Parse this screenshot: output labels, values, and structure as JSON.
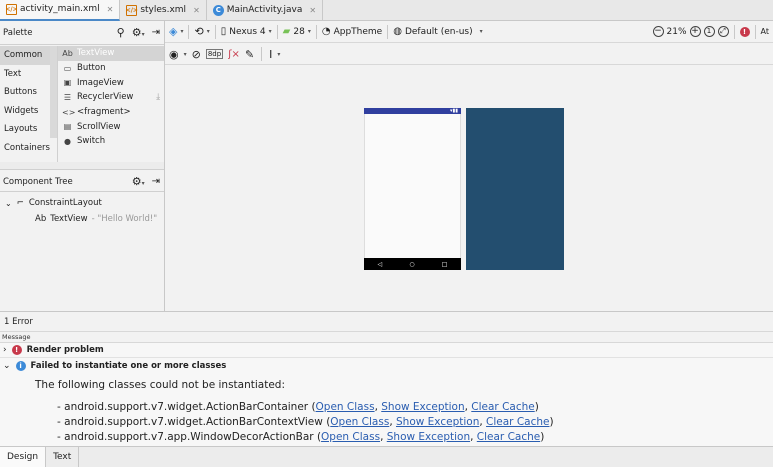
{
  "tabs": [
    {
      "label": "activity_main.xml",
      "icon": "xml-file-icon",
      "active": true
    },
    {
      "label": "styles.xml",
      "icon": "xml-file-icon",
      "active": false
    },
    {
      "label": "MainActivity.java",
      "icon": "java-class-icon",
      "active": false
    }
  ],
  "palette": {
    "title": "Palette",
    "categories": [
      "Common",
      "Text",
      "Buttons",
      "Widgets",
      "Layouts",
      "Containers"
    ],
    "items": [
      {
        "icon_text": "Ab",
        "label": "TextView"
      },
      {
        "icon_text": "▭",
        "label": "Button"
      },
      {
        "icon_text": "▣",
        "label": "ImageView"
      },
      {
        "icon_text": "☰",
        "label": "RecyclerView"
      },
      {
        "icon_text": "<>",
        "label": "<fragment>"
      },
      {
        "icon_text": "▤",
        "label": "ScrollView"
      },
      {
        "icon_text": "●",
        "label": "Switch"
      }
    ]
  },
  "component_tree": {
    "title": "Component Tree",
    "root": "ConstraintLayout",
    "child_icon": "Ab",
    "child": "TextView",
    "child_detail": "- \"Hello World!\""
  },
  "toolbar": {
    "device": "Nexus 4",
    "api": "28",
    "theme": "AppTheme",
    "locale": "Default (en-us)",
    "zoom": "21%",
    "margin": "8dp",
    "right_edge_label": "At"
  },
  "errors": {
    "count_label": "1 Error",
    "column_header": "Message",
    "render_problem": "Render problem",
    "failed_title": "Failed to instantiate one or more classes",
    "intro": "The following classes could not be instantiated:",
    "classes": [
      "android.support.v7.widget.ActionBarContainer",
      "android.support.v7.widget.ActionBarContextView",
      "android.support.v7.app.WindowDecorActionBar"
    ],
    "open_class": "Open Class",
    "show_exception": "Show Exception",
    "clear_cache": "Clear Cache"
  },
  "bottom_tabs": [
    "Design",
    "Text"
  ],
  "colors": {
    "status_bar": "#303f9f",
    "blueprint": "#234e6f",
    "error_red": "#c8394b",
    "info_blue": "#3c8ad8",
    "link": "#2a5db0"
  }
}
